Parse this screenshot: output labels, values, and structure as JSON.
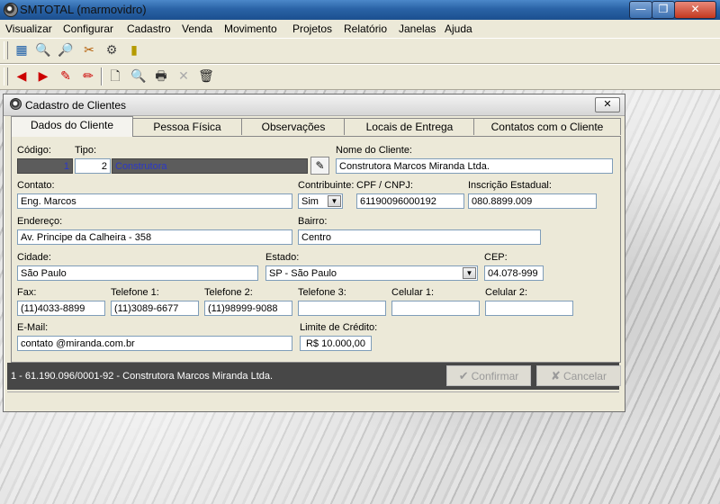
{
  "app": {
    "title": "SMTOTAL (marmovidro)",
    "window_buttons": {
      "minimize": "—",
      "maximize": "❐",
      "close": "✕"
    }
  },
  "menu": [
    "Visualizar",
    "Configurar",
    "Cadastro",
    "Venda",
    "Movimento",
    "Projetos",
    "Relatório",
    "Janelas",
    "Ajuda"
  ],
  "toolbar1": [
    {
      "name": "calculator-icon",
      "glyph": "▦"
    },
    {
      "name": "key-icon",
      "glyph": "🔍"
    },
    {
      "name": "search-document-icon",
      "glyph": "🔎"
    },
    {
      "name": "tools-icon",
      "glyph": "✂"
    },
    {
      "name": "users-icon",
      "glyph": "⚙"
    },
    {
      "name": "exit-door-icon",
      "glyph": "▮"
    }
  ],
  "toolbar2": [
    {
      "name": "first-record-icon",
      "glyph": "◀"
    },
    {
      "name": "next-record-icon",
      "glyph": "▶"
    },
    {
      "name": "edit-pencil-icon",
      "glyph": "✎"
    },
    {
      "name": "cancel-pencil-icon",
      "glyph": "✏"
    },
    {
      "name": "new-document-icon",
      "glyph": "🗋"
    },
    {
      "name": "search-record-icon",
      "glyph": "🔍"
    },
    {
      "name": "print-icon",
      "glyph": "🖶"
    },
    {
      "name": "delete-x-icon",
      "glyph": "✕"
    },
    {
      "name": "trash-icon",
      "glyph": "🗑"
    }
  ],
  "child": {
    "title": "Cadastro de Clientes",
    "close": "✕",
    "tabs": [
      "Dados do Cliente",
      "Pessoa Física",
      "Observações",
      "Locais de Entrega",
      "Contatos com o Cliente"
    ]
  },
  "form": {
    "codigo_label": "Código:",
    "codigo": "1",
    "tipo_label": "Tipo:",
    "tipo_code": "2",
    "tipo_name": "Construtora",
    "nome_label": "Nome do Cliente:",
    "nome": "Construtora Marcos Miranda Ltda.",
    "contato_label": "Contato:",
    "contato": "Eng. Marcos",
    "contribuinte_label": "Contribuinte:",
    "contribuinte": "Sim",
    "cpf_label": "CPF / CNPJ:",
    "cpf": "61190096000192",
    "ie_label": "Inscrição Estadual:",
    "ie": "080.8899.009",
    "endereco_label": "Endereço:",
    "endereco": "Av. Principe da Calheira - 358",
    "bairro_label": "Bairro:",
    "bairro": "Centro",
    "cidade_label": "Cidade:",
    "cidade": "São Paulo",
    "estado_label": "Estado:",
    "estado": "SP - São Paulo",
    "cep_label": "CEP:",
    "cep": "04.078-999",
    "fax_label": "Fax:",
    "fax": "(11)4033-8899",
    "tel1_label": "Telefone 1:",
    "tel1": "(11)3089-6677",
    "tel2_label": "Telefone 2:",
    "tel2": "(11)98999-9088",
    "tel3_label": "Telefone 3:",
    "tel3": "",
    "cel1_label": "Celular 1:",
    "cel1": "",
    "cel2_label": "Celular 2:",
    "cel2": "",
    "email_label": "E-Mail:",
    "email": "contato @miranda.com.br",
    "limite_label": "Limite de Crédito:",
    "limite": "R$ 10.000,00"
  },
  "status": {
    "text": "1 - 61.190.096/0001-92 - Construtora Marcos Miranda Ltda.",
    "confirm": "Confirmar",
    "cancel": "Cancelar"
  }
}
